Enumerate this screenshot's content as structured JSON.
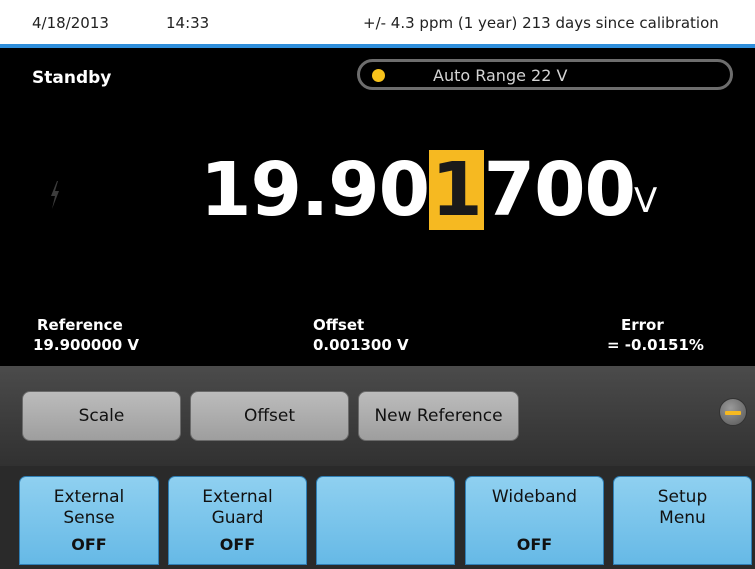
{
  "status_bar": {
    "date": "4/18/2013",
    "time": "14:33",
    "calibration": "+/- 4.3 ppm (1 year)  213 days since calibration"
  },
  "state": "Standby",
  "range": {
    "label": "Auto Range 22 V",
    "indicator_color": "#f7c21b"
  },
  "reading": {
    "prefix": "19.90",
    "highlighted_digit": "1",
    "suffix": "700",
    "unit": "V",
    "highlight_color": "#f6b921"
  },
  "info": {
    "reference": {
      "label": "Reference",
      "value": "19.900000 V"
    },
    "offset": {
      "label": "Offset",
      "value": "0.001300 V"
    },
    "error": {
      "label": "Error",
      "value": "=  -0.0151%"
    }
  },
  "soft_buttons": [
    {
      "label": "Scale"
    },
    {
      "label": "Offset"
    },
    {
      "label": "New Reference"
    }
  ],
  "function_keys": [
    {
      "label_line1": "External",
      "label_line2": "Sense",
      "value": "OFF"
    },
    {
      "label_line1": "External",
      "label_line2": "Guard",
      "value": "OFF"
    },
    {
      "label_line1": "",
      "label_line2": "",
      "value": ""
    },
    {
      "label_line1": "Wideband",
      "label_line2": "",
      "value": "OFF"
    },
    {
      "label_line1": "Setup",
      "label_line2": "Menu",
      "value": ""
    }
  ],
  "icons": {
    "high_voltage": "lightning-bolt-icon",
    "minus": "minus-icon"
  },
  "colors": {
    "accent_blue": "#2f8fdc",
    "fkey_blue": "#7cc6ee",
    "highlight": "#f6b921"
  }
}
